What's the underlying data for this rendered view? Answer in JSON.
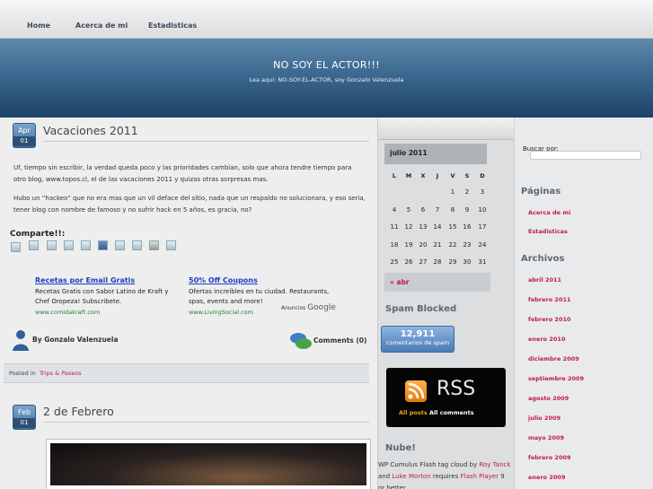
{
  "nav": {
    "items": [
      "Home",
      "Acerca de mi",
      "Estadisticas"
    ]
  },
  "header": {
    "title": "NO SOY EL ACTOR!!!",
    "subtitle": "Lea aqui: NO-SOY-EL-ACTOR, soy Gonzalo Valenzuela"
  },
  "post1": {
    "month": "Apr",
    "day": "01",
    "title": "Vacaciones 2011",
    "p1": "Uf, tiempo sin escribir, la verdad queda poco y las prioridades cambian, solo que ahora tendre tiempo para otro blog, www.topos.cl, el de las vacaciones 2011 y quizas otras sorpresas mas.",
    "p2": "Hubo un “hackeo” que no era mas que un vil deface del sitio, nada que un respaldo no solucionara, y eso seria, tener blog con nombre de famoso y no sufrir hack en 5 años, es gracia, no?",
    "share_label": "Comparte!!:",
    "ads": [
      {
        "title": "Recetas por Email Gratis",
        "text": "Recetas Gratis con Sabor Latino de Kraft y Chef Oropeza! Subscribete.",
        "url": "www.comidakraft.com"
      },
      {
        "title": "50% Off Coupons",
        "text": "Ofertas increíbles en tu ciudad. Restaurants, spas, events and more!",
        "url": "www.LivingSocial.com"
      }
    ],
    "ads_label": "Anuncios",
    "ads_brand": "Google",
    "author_prefix": "By",
    "author": "Gonzalo Valenzuela",
    "comments": "Comments (0)",
    "posted_in_prefix": "Posted in",
    "category": "Trips & Paseos"
  },
  "post2": {
    "month": "Feb",
    "day": "01",
    "title": "2 de Febrero"
  },
  "calendar": {
    "month": "julio 2011",
    "dow": [
      "L",
      "M",
      "X",
      "J",
      "V",
      "S",
      "D"
    ],
    "weeks": [
      [
        "",
        "",
        "",
        "",
        "1",
        "2",
        "3"
      ],
      [
        "4",
        "5",
        "6",
        "7",
        "8",
        "9",
        "10"
      ],
      [
        "11",
        "12",
        "13",
        "14",
        "15",
        "16",
        "17"
      ],
      [
        "18",
        "19",
        "20",
        "21",
        "22",
        "23",
        "24"
      ],
      [
        "25",
        "26",
        "27",
        "28",
        "29",
        "30",
        "31"
      ]
    ],
    "prev": "« abr"
  },
  "spam": {
    "title": "Spam Blocked",
    "count": "12,911",
    "label": "comentarios de spam"
  },
  "rss": {
    "word": "RSS",
    "all_posts": "All posts",
    "all_comments": "All comments"
  },
  "nube": {
    "title": "Nube!",
    "t1": "WP Cumulus Flash tag cloud by ",
    "l1": "Roy Tanck",
    "t2": " and ",
    "l2": "Luke Morton",
    "t3": " requires ",
    "l3": "Flash Player",
    "t4": " 9 or better."
  },
  "search": {
    "label": "Buscar por:",
    "placeholder": ""
  },
  "pages": {
    "title": "Páginas",
    "items": [
      "Acerca de mi",
      "Estadisticas"
    ]
  },
  "archives": {
    "title": "Archivos",
    "items": [
      "abril 2011",
      "febrero 2011",
      "febrero 2010",
      "enero 2010",
      "diciembre 2009",
      "septiembre 2009",
      "agosto 2009",
      "julio 2009",
      "mayo 2009",
      "febrero 2009",
      "enero 2009"
    ]
  },
  "colors": {
    "accent": "#c01a55",
    "banner": "#3f6c93",
    "link": "#1b3fc4"
  }
}
